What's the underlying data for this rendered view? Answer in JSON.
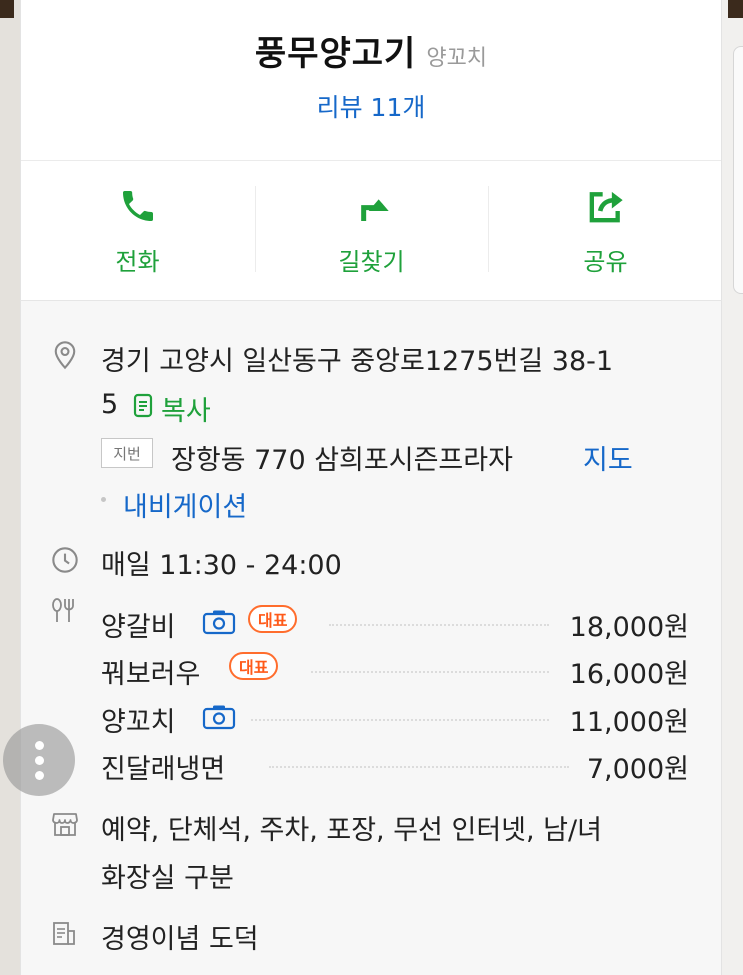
{
  "place": {
    "name": "풍무양고기",
    "category": "양꼬치",
    "reviews_label": "리뷰 11개"
  },
  "actions": [
    {
      "label": "전화",
      "icon": "phone-icon"
    },
    {
      "label": "길찾기",
      "icon": "route-icon"
    },
    {
      "label": "공유",
      "icon": "share-icon"
    }
  ],
  "address": {
    "line1": "경기 고양시 일산동구 중앙로1275번길 38-1",
    "line2": "5",
    "copy_label": "복사",
    "jibun_badge": "지번",
    "jibun_text": "장항동 770 삼희포시즌프라자",
    "map_link": "지도",
    "navigation_link": "내비게이션"
  },
  "hours": "매일 11:30 - 24:00",
  "menu": [
    {
      "name": "양갈비",
      "photo": true,
      "rep": true,
      "rep_label": "대표",
      "price": "18,000원"
    },
    {
      "name": "꿔보러우",
      "photo": false,
      "rep": true,
      "rep_label": "대표",
      "price": "16,000원"
    },
    {
      "name": "양꼬치",
      "photo": true,
      "rep": false,
      "price": "11,000원"
    },
    {
      "name": "진달래냉면",
      "photo": false,
      "rep": false,
      "price": "7,000원"
    }
  ],
  "facilities": {
    "line1": "예약, 단체석, 주차, 포장, 무선 인터넷, 남/녀",
    "line2": "화장실 구분"
  },
  "description": "경영이념 도덕",
  "colors": {
    "green": "#1fa13b",
    "blue": "#1668c9",
    "badge_orange": "#ff6d2d"
  }
}
